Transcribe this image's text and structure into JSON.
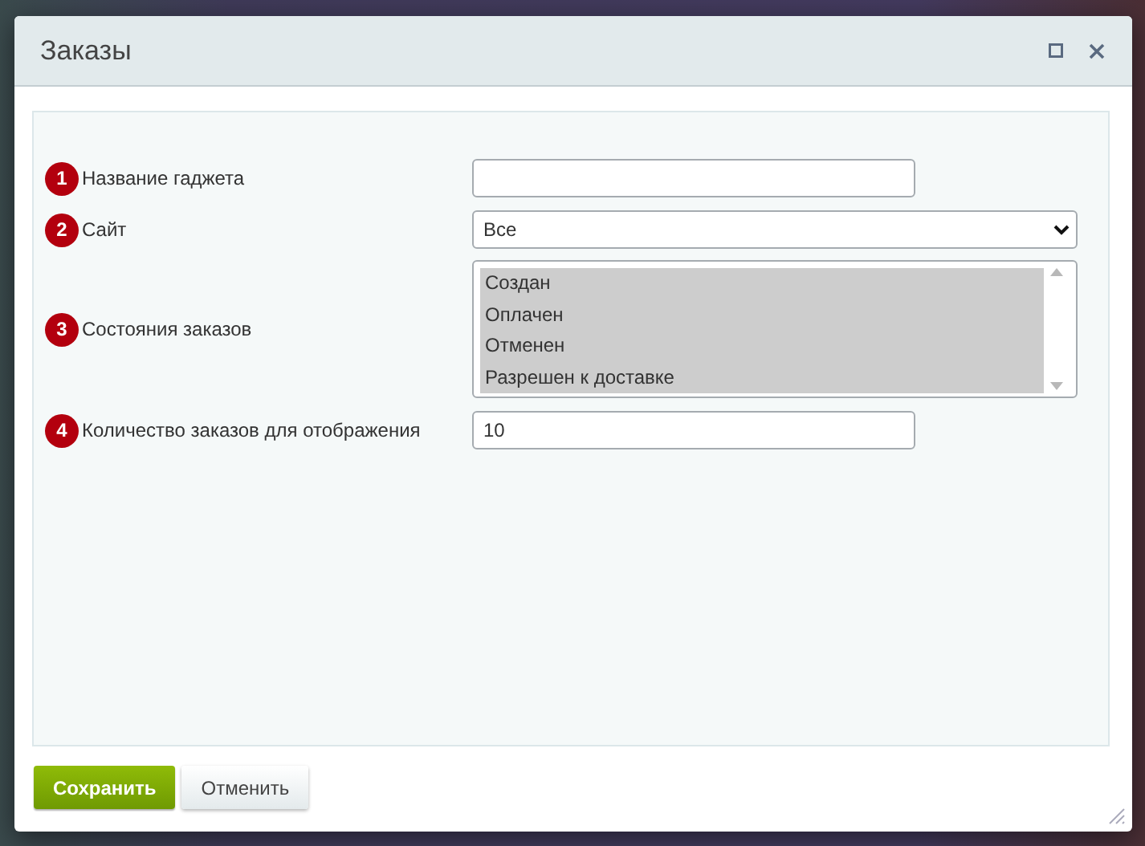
{
  "dialog": {
    "title": "Заказы"
  },
  "fields": [
    {
      "number": "1",
      "label": "Название гаджета",
      "kind": "text"
    },
    {
      "number": "2",
      "label": "Сайт",
      "kind": "select",
      "value": "Все"
    },
    {
      "number": "3",
      "label": "Состояния заказов",
      "kind": "multiselect",
      "options": [
        {
          "label": "Создан",
          "selected": true
        },
        {
          "label": "Оплачен",
          "selected": true
        },
        {
          "label": "Отменен",
          "selected": true
        },
        {
          "label": "Разрешен к доставке",
          "selected": true
        }
      ]
    },
    {
      "number": "4",
      "label": "Количество заказов для отображения",
      "kind": "short",
      "value": "10"
    }
  ],
  "buttons": [
    {
      "label": "Сохранить",
      "kind": "primary"
    },
    {
      "label": "Отменить",
      "kind": "secondary"
    }
  ]
}
